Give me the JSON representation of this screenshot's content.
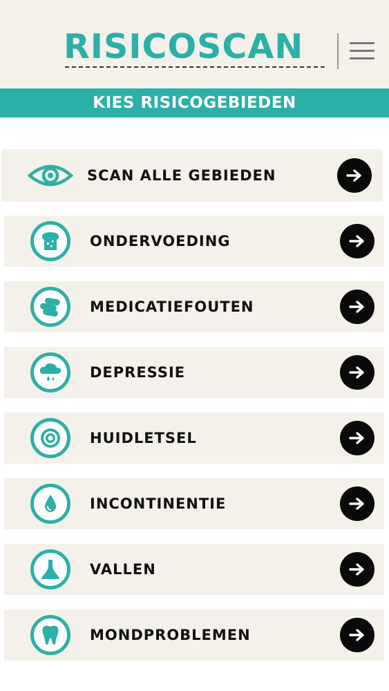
{
  "header": {
    "logo_text": "RISICOSCAN",
    "menu_icon": "hamburger-menu-icon"
  },
  "banner": {
    "title": "KIES RISICOGEBIEDEN"
  },
  "colors": {
    "accent": "#2bb0a8",
    "row_background": "#f3f1ea",
    "arrow_background": "#0a0a0a"
  },
  "items": [
    {
      "label": "SCAN ALLE GEBIEDEN",
      "icon": "eye-icon"
    },
    {
      "label": "ONDERVOEDING",
      "icon": "bread-icon"
    },
    {
      "label": "MEDICATIEFOUTEN",
      "icon": "pills-icon"
    },
    {
      "label": "DEPRESSIE",
      "icon": "rain-cloud-icon"
    },
    {
      "label": "HUIDLETSEL",
      "icon": "target-icon"
    },
    {
      "label": "INCONTINENTIE",
      "icon": "droplet-icon"
    },
    {
      "label": "VALLEN",
      "icon": "bell-icon"
    },
    {
      "label": "MONDPROBLEMEN",
      "icon": "tooth-icon"
    }
  ]
}
